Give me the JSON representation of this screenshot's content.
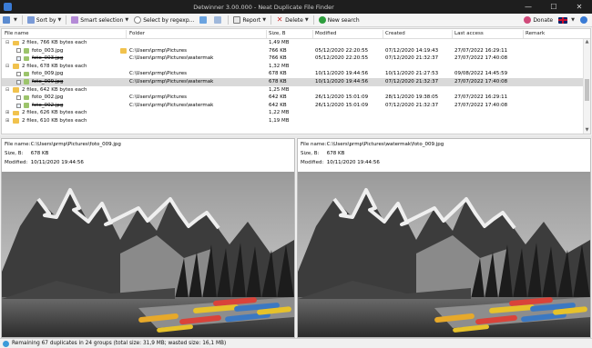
{
  "window": {
    "title": "Detwinner 3.00.000 - Neat Duplicate File Finder",
    "minimize": "—",
    "maximize": "☐",
    "close": "✕"
  },
  "toolbar": {
    "sort_by": "Sort by",
    "smart_selection": "Smart selection",
    "select_by_regexp": "Select by regexp...",
    "report": "Report",
    "delete": "Delete",
    "new_search": "New search",
    "donate": "Donate"
  },
  "grid": {
    "columns": {
      "file_name": "File name",
      "folder": "Folder",
      "size": "Size, B",
      "modified": "Modified",
      "created": "Created",
      "last_access": "Last access",
      "remark": "Remark"
    },
    "rows": [
      {
        "type": "group",
        "name": "2 files, 766 KB bytes each",
        "size": "1,49 MB"
      },
      {
        "type": "file",
        "name": "foto_003.jpg",
        "folder": "C:\\Users\\prmp\\Pictures",
        "size": "766 KB",
        "modified": "05/12/2020 22:20:55",
        "created": "07/12/2020 14:19:43",
        "accessed": "27/07/2022 16:29:11",
        "checked": false,
        "struck": false,
        "selected": false
      },
      {
        "type": "file",
        "name": "foto_003.jpg",
        "folder": "C:\\Users\\prmp\\Pictures\\watermak",
        "size": "766 KB",
        "modified": "05/12/2020 22:20:55",
        "created": "07/12/2020 21:32:37",
        "accessed": "27/07/2022 17:40:08",
        "checked": true,
        "struck": true,
        "selected": false
      },
      {
        "type": "group",
        "name": "2 files, 678 KB bytes each",
        "size": "1,32 MB"
      },
      {
        "type": "file",
        "name": "foto_009.jpg",
        "folder": "C:\\Users\\prmp\\Pictures",
        "size": "678 KB",
        "modified": "10/11/2020 19:44:56",
        "created": "10/11/2020 21:27:53",
        "accessed": "09/08/2022 14:45:59",
        "checked": false,
        "struck": false,
        "selected": false
      },
      {
        "type": "file",
        "name": "foto_009.jpg",
        "folder": "C:\\Users\\prmp\\Pictures\\watermak",
        "size": "678 KB",
        "modified": "10/11/2020 19:44:56",
        "created": "07/12/2020 21:32:37",
        "accessed": "27/07/2022 17:40:08",
        "checked": true,
        "struck": true,
        "selected": true
      },
      {
        "type": "group",
        "name": "2 files, 642 KB bytes each",
        "size": "1,25 MB"
      },
      {
        "type": "file",
        "name": "foto_002.jpg",
        "folder": "C:\\Users\\prmp\\Pictures",
        "size": "642 KB",
        "modified": "26/11/2020 15:01:09",
        "created": "28/11/2020 19:38:05",
        "accessed": "27/07/2022 16:29:11",
        "checked": false,
        "struck": false,
        "selected": false
      },
      {
        "type": "file",
        "name": "foto_002.jpg",
        "folder": "C:\\Users\\prmp\\Pictures\\watermak",
        "size": "642 KB",
        "modified": "26/11/2020 15:01:09",
        "created": "07/12/2020 21:32:37",
        "accessed": "27/07/2022 17:40:08",
        "checked": true,
        "struck": true,
        "selected": false
      },
      {
        "type": "group",
        "name": "2 files, 626 KB bytes each",
        "size": "1,22 MB"
      },
      {
        "type": "group",
        "name": "2 files, 610 KB bytes each",
        "size": "1,19 MB"
      }
    ]
  },
  "preview": {
    "left": {
      "file_name_label": "File name:",
      "file_name": "C:\\Users\\prmp\\Pictures\\foto_009.jpg",
      "size_label": "Size, B:",
      "size": "678 KB",
      "modified_label": "Modified:",
      "modified": "10/11/2020 19:44:56"
    },
    "right": {
      "file_name_label": "File name:",
      "file_name": "C:\\Users\\prmp\\Pictures\\watermak\\foto_009.jpg",
      "size_label": "Size, B:",
      "size": "678 KB",
      "modified_label": "Modified:",
      "modified": "10/11/2020 19:44:56"
    }
  },
  "status": {
    "text": "Remaining 67 duplicates in 24 groups (total size: 31,9 MB; wasted size: 16,1 MB)"
  },
  "icons": {
    "folder": "folder-icon",
    "image": "image-file-icon",
    "expand": "expand-icon",
    "flag": "uk-flag-icon"
  },
  "colors": {
    "titlebar": "#1e1e1e",
    "folder": "#f1c24d",
    "selection": "#d9d9d9",
    "delete": "#d32f2f",
    "new_search": "#2e9e3e"
  }
}
